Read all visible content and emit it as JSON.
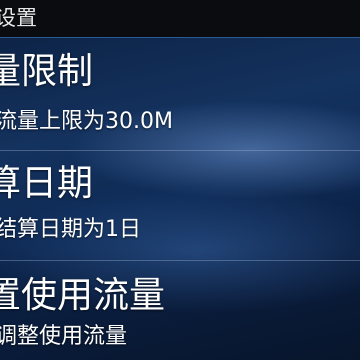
{
  "header": {
    "title": "设置"
  },
  "settings": {
    "items": [
      {
        "title": "量限制",
        "subtitle": "流量上限为30.0M"
      },
      {
        "title": "算日期",
        "subtitle": "结算日期为1日"
      },
      {
        "title": "置使用流量",
        "subtitle": "调整使用流量"
      }
    ]
  },
  "colors": {
    "header_background": "#0a0c10",
    "accent_line": "#2a5a93",
    "text": "#ffffff"
  }
}
